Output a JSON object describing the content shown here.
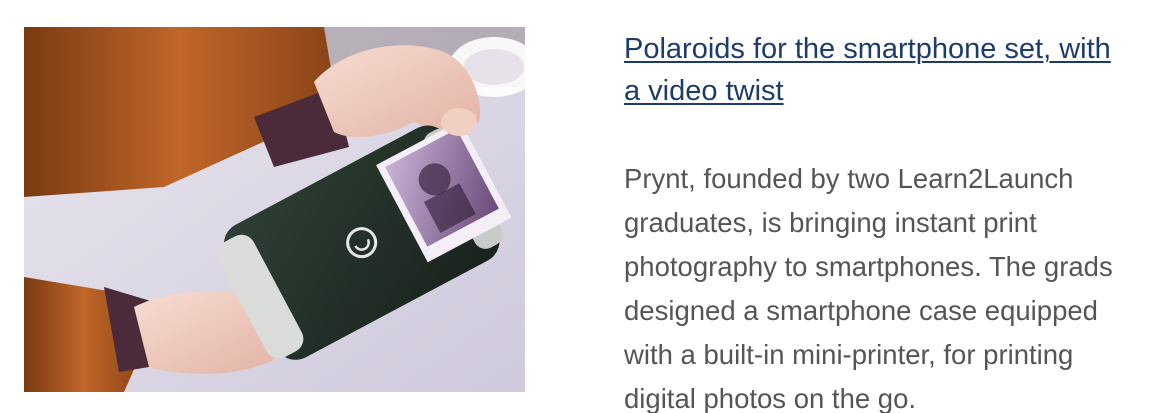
{
  "article": {
    "headline": "Polaroids for the smartphone set, with a video twist",
    "summary": "Prynt, founded by two Learn2Launch graduates, is bringing instant print photography to smartphones. The grads designed a smartphone case equipped with a built-in mini-printer, for printing digital photos on the go.",
    "image_alt": "Hands holding a phone printer case ejecting a printed photo",
    "colors": {
      "headline_link": "#1d3c6e",
      "summary_text": "#555555",
      "background": "#ffffff"
    }
  }
}
